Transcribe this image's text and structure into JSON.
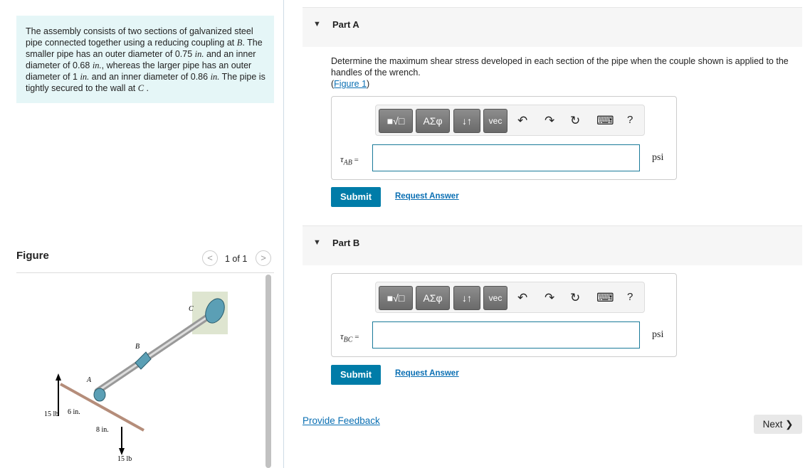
{
  "problem": {
    "text_html": "The assembly consists of two sections of galvanized steel pipe connected together using a reducing coupling at <i>B</i>. The smaller pipe has an outer diameter of 0.75 <i>in.</i> and an inner diameter of 0.68 <i>in.</i>, whereas the larger pipe has an outer diameter of 1 <i>in.</i> and an inner diameter of 0.86 <i>in.</i> The pipe is tightly secured to the wall at <i>C</i> ."
  },
  "figure": {
    "title": "Figure",
    "pagination": "1 of 1",
    "prev": "<",
    "next": ">",
    "labels": {
      "A": "A",
      "B": "B",
      "C": "C",
      "f1": "15 lb",
      "f2": "15 lb",
      "d1": "6 in.",
      "d2": "8 in."
    }
  },
  "partA": {
    "label": "Part A",
    "question": "Determine the maximum shear stress developed in each section of the pipe when the couple shown is applied to the handles of the wrench.",
    "figure_link": "Figure 1",
    "var": "τ",
    "sub": "AB",
    "eq": " =",
    "value": "",
    "unit": "psi",
    "submit": "Submit",
    "request": "Request Answer"
  },
  "partB": {
    "label": "Part B",
    "var": "τ",
    "sub": "BC",
    "eq": " =",
    "value": "",
    "unit": "psi",
    "submit": "Submit",
    "request": "Request Answer"
  },
  "toolbar": {
    "templates": "■√□",
    "greek": "ΑΣφ",
    "arrows": "↓↑",
    "vec": "vec",
    "undo": "↶",
    "redo": "↷",
    "reset": "↻",
    "keyboard": "⌨",
    "help": "?"
  },
  "footer": {
    "feedback": "Provide Feedback",
    "next": "Next ❯"
  },
  "colors": {
    "accent": "#007ca8",
    "problem_bg": "#e5f6f7"
  }
}
